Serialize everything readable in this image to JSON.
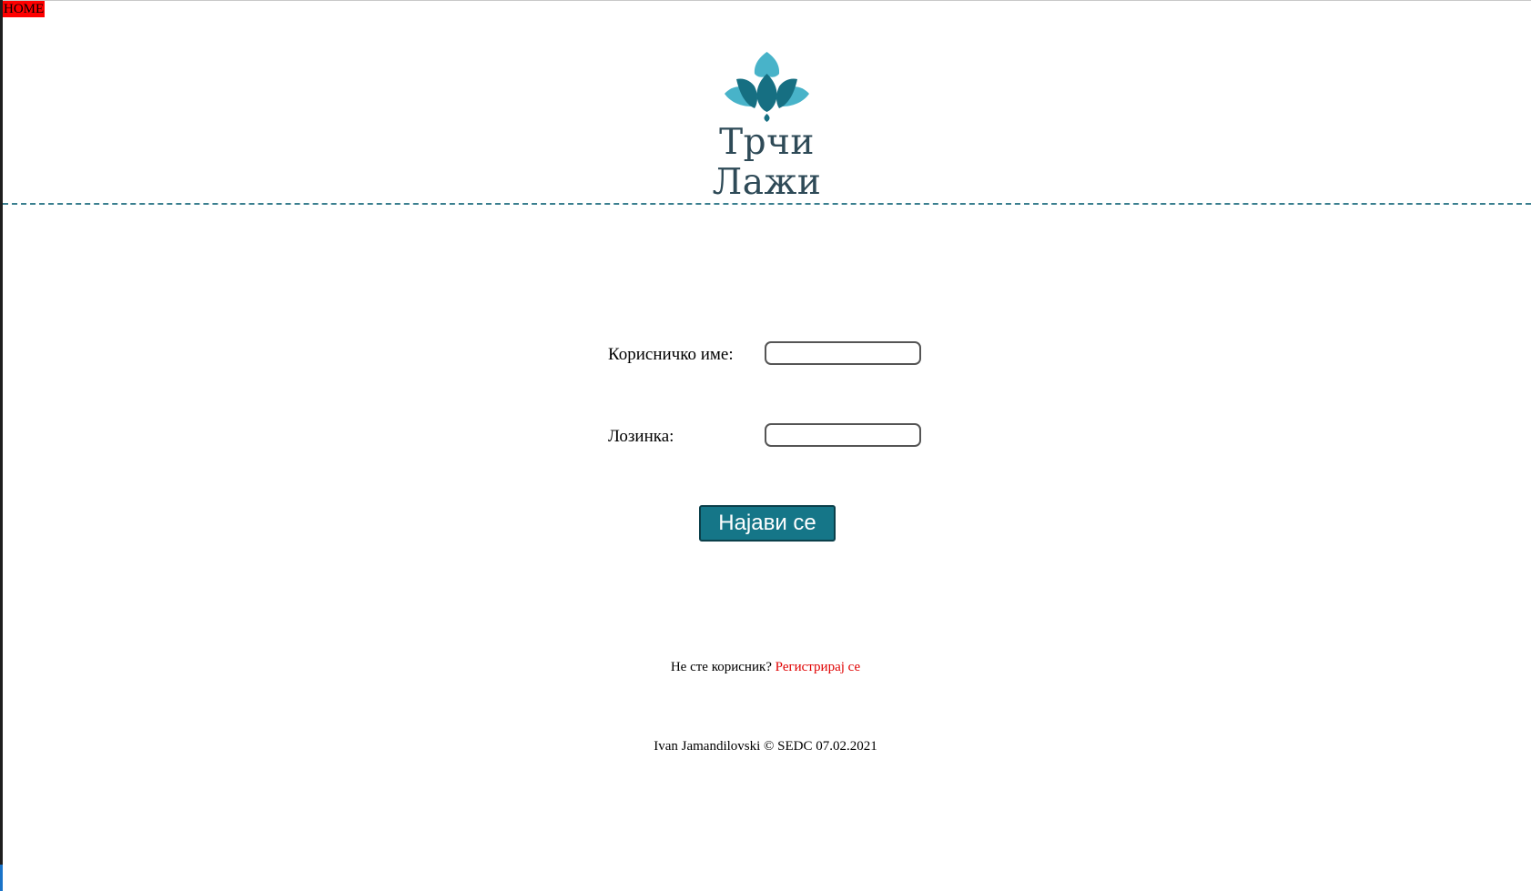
{
  "nav": {
    "home_label": "HOME"
  },
  "logo": {
    "icon": "lotus-icon",
    "name": "Трчи Лажи",
    "colors": {
      "petal_light": "#48b3c9",
      "petal_dark": "#166f82",
      "text": "#2e4a57"
    }
  },
  "form": {
    "username_label": "Корисничко име:",
    "username_value": "",
    "password_label": "Лозинка:",
    "password_value": "",
    "submit_label": "Најави се"
  },
  "register": {
    "prompt": "Не сте корисник?",
    "link_label": "Регистрирај се"
  },
  "footer": {
    "text": "Ivan Jamandilovski © SEDC 07.02.2021"
  },
  "colors": {
    "accent": "#157688",
    "divider": "#3a7f8f",
    "home_background": "#ff0000",
    "link": "#e00000"
  }
}
